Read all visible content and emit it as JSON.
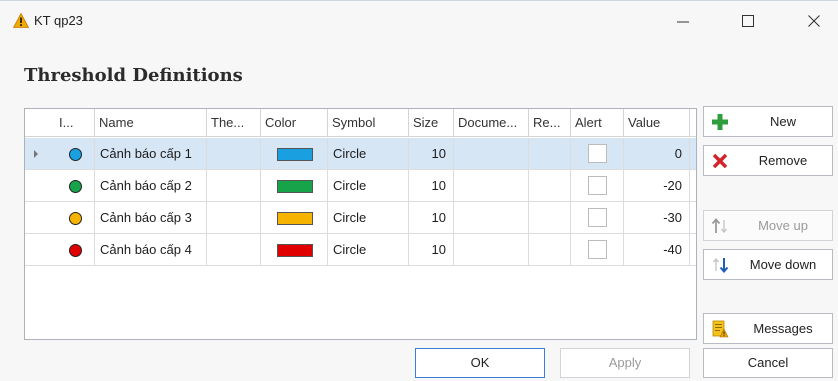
{
  "window": {
    "title": "KT qp23"
  },
  "heading": "Threshold Definitions",
  "grid": {
    "columns": [
      "I...",
      "Name",
      "The...",
      "Color",
      "Symbol",
      "Size",
      "Docume...",
      "Re...",
      "Alert",
      "Value"
    ],
    "rows": [
      {
        "name": "Cảnh báo cấp 1",
        "color": "#1aa0e0",
        "symbol": "Circle",
        "size": "10",
        "alert": false,
        "value": "0",
        "selected": true
      },
      {
        "name": "Cảnh báo cấp 2",
        "color": "#16a34a",
        "symbol": "Circle",
        "size": "10",
        "alert": false,
        "value": "-20",
        "selected": false
      },
      {
        "name": "Cảnh báo cấp 3",
        "color": "#f6b400",
        "symbol": "Circle",
        "size": "10",
        "alert": false,
        "value": "-30",
        "selected": false
      },
      {
        "name": "Cảnh báo cấp 4",
        "color": "#e00000",
        "symbol": "Circle",
        "size": "10",
        "alert": false,
        "value": "-40",
        "selected": false
      }
    ]
  },
  "side_buttons": {
    "new": "New",
    "remove": "Remove",
    "move_up": "Move up",
    "move_down": "Move down",
    "messages": "Messages"
  },
  "bottom_buttons": {
    "ok": "OK",
    "apply": "Apply",
    "cancel": "Cancel"
  },
  "icons": {
    "app": "warning-icon",
    "new": "plus-icon",
    "remove": "x-icon",
    "move_up": "arrow-up-icon",
    "move_down": "arrow-down-icon",
    "messages": "messages-icon"
  }
}
